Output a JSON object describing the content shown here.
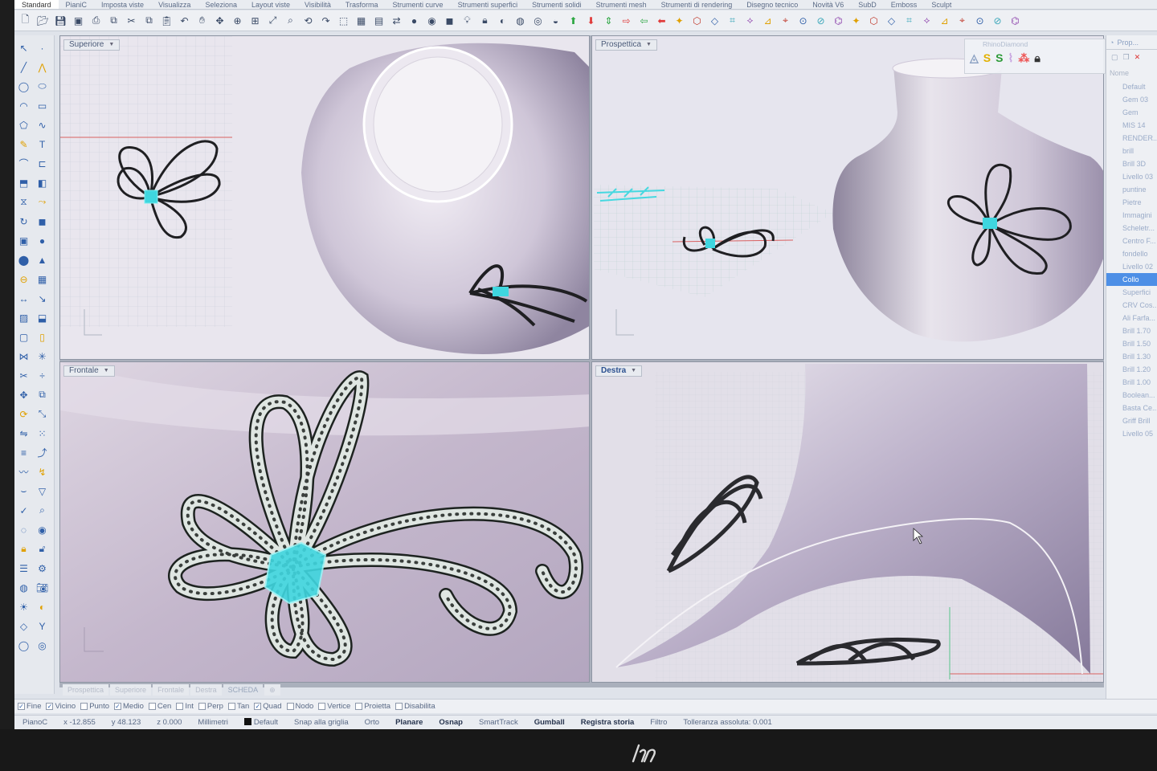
{
  "menu_tabs": [
    "Standard",
    "PianiC",
    "Imposta viste",
    "Visualizza",
    "Seleziona",
    "Layout viste",
    "Visibilità",
    "Trasforma",
    "Strumenti curve",
    "Strumenti superfici",
    "Strumenti solidi",
    "Strumenti mesh",
    "Strumenti di rendering",
    "Disegno tecnico",
    "Novità V6",
    "SubD",
    "Emboss",
    "Sculpt"
  ],
  "active_menu_tab": "Standard",
  "viewports": {
    "top": {
      "label": "Superiore"
    },
    "perspective": {
      "label": "Prospettica"
    },
    "front": {
      "label": "Frontale"
    },
    "right": {
      "label": "Destra"
    }
  },
  "floating_toolbar": {
    "title": "RhinoDiamond"
  },
  "right_panel": {
    "tab_label": "Prop...",
    "header": "Nome",
    "layers": [
      "Default",
      "Gem 03",
      "Gem",
      "MIS 14",
      "RENDER...",
      "brill",
      "Brill 3D",
      "Livello 03",
      "puntine",
      "Pietre",
      "Immagini",
      "Scheletr...",
      "Centro F...",
      "fondello",
      "Livello 02",
      "Collo",
      "Superfici",
      "CRV Cos...",
      "Ali Farfa...",
      "Brill 1.70",
      "Brill 1.50",
      "Brill 1.30",
      "Brill 1.20",
      "Brill 1.00",
      "Boolean...",
      "Basta Ce...",
      "Griff Brill",
      "Livello 05"
    ],
    "selected_layer": "Collo"
  },
  "view_tabs": [
    "Prospettica",
    "Superiore",
    "Frontale",
    "Destra",
    "SCHEDA"
  ],
  "osnap": [
    {
      "label": "Fine",
      "checked": true
    },
    {
      "label": "Vicino",
      "checked": true
    },
    {
      "label": "Punto",
      "checked": false
    },
    {
      "label": "Medio",
      "checked": true
    },
    {
      "label": "Cen",
      "checked": false
    },
    {
      "label": "Int",
      "checked": false
    },
    {
      "label": "Perp",
      "checked": false
    },
    {
      "label": "Tan",
      "checked": false
    },
    {
      "label": "Quad",
      "checked": true
    },
    {
      "label": "Nodo",
      "checked": false
    },
    {
      "label": "Vertice",
      "checked": false
    },
    {
      "label": "Proietta",
      "checked": false
    },
    {
      "label": "Disabilita",
      "checked": false
    }
  ],
  "status": {
    "cplane": "PianoC",
    "x": "x -12.855",
    "y": "y 48.123",
    "z": "z 0.000",
    "units": "Millimetri",
    "layer": "Default",
    "toggles": [
      {
        "label": "Snap alla griglia",
        "on": false
      },
      {
        "label": "Orto",
        "on": false
      },
      {
        "label": "Planare",
        "on": true
      },
      {
        "label": "Osnap",
        "on": true
      },
      {
        "label": "SmartTrack",
        "on": false
      },
      {
        "label": "Gumball",
        "on": true
      },
      {
        "label": "Registra storia",
        "on": true
      },
      {
        "label": "Filtro",
        "on": false
      }
    ],
    "tolerance": "Tolleranza assoluta: 0.001"
  },
  "colors": {
    "accent": "#4d8fe6",
    "selection": "#41e0e6",
    "neck": "#a79bb6",
    "jewel": "#1f1f22"
  }
}
